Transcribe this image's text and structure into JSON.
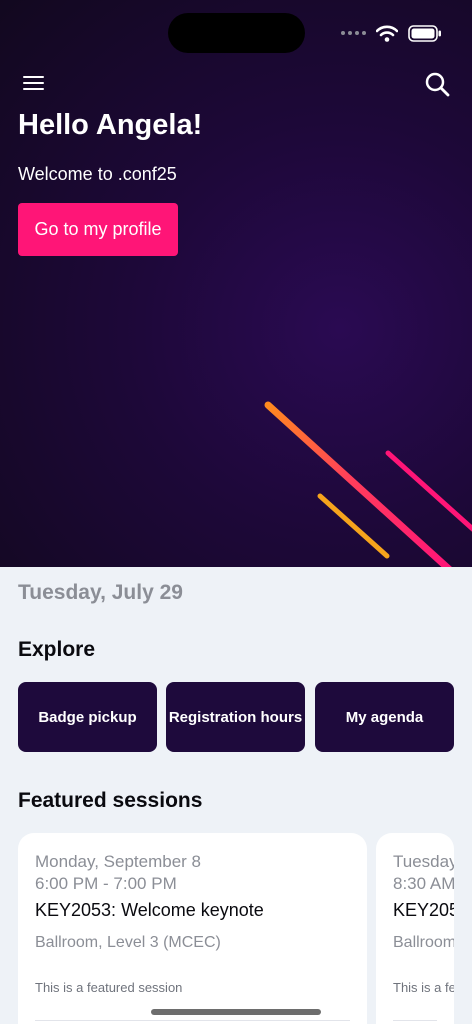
{
  "header": {
    "greeting": "Hello Angela!",
    "welcome": "Welcome to .conf25",
    "profile_button": "Go to my profile"
  },
  "date": "Tuesday, July 29",
  "explore": {
    "title": "Explore",
    "tiles": [
      "Badge pickup",
      "Registration hours",
      "My agenda"
    ]
  },
  "featured": {
    "title": "Featured sessions",
    "sessions": [
      {
        "date": "Monday, September 8",
        "time": "6:00 PM - 7:00 PM",
        "title": "KEY2053: Welcome keynote",
        "location": "Ballroom, Level 3 (MCEC)",
        "note": "This is a featured session"
      },
      {
        "date": "Tuesday",
        "time": "8:30 AM",
        "title": "KEY205",
        "location": "Ballroom",
        "note": "This is a fe"
      }
    ]
  },
  "icons": {
    "menu": "hamburger-menu-icon",
    "search": "search-icon",
    "wifi": "wifi-icon",
    "battery": "battery-icon"
  },
  "colors": {
    "accent": "#ff1577",
    "hero_background": "#1d0838",
    "tile_background": "#1e0a3c",
    "page_background": "#eef2f7"
  }
}
